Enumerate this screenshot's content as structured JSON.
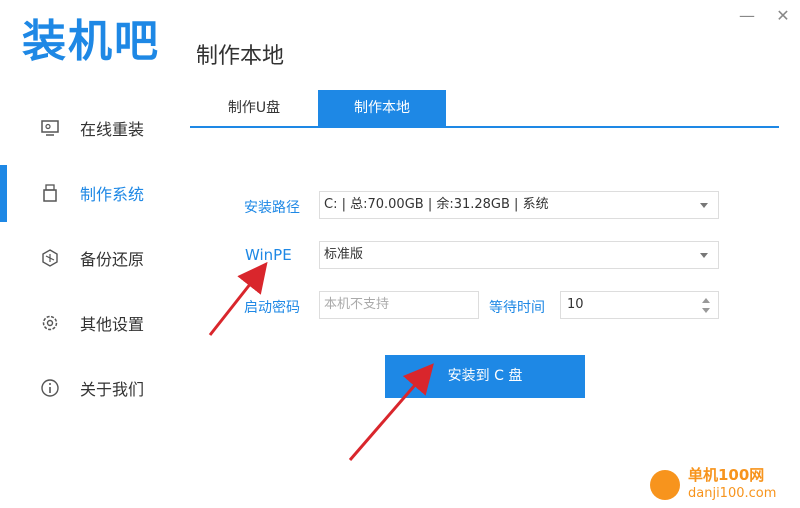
{
  "app": {
    "logo_text": "装机吧"
  },
  "window": {
    "minimize_label": "—",
    "close_label": "✕"
  },
  "sidebar": {
    "items": [
      {
        "label": "在线重装",
        "icon": "monitor-icon",
        "active": false
      },
      {
        "label": "制作系统",
        "icon": "usb-icon",
        "active": true
      },
      {
        "label": "备份还原",
        "icon": "backup-icon",
        "active": false
      },
      {
        "label": "其他设置",
        "icon": "gear-icon",
        "active": false
      },
      {
        "label": "关于我们",
        "icon": "info-icon",
        "active": false
      }
    ]
  },
  "main": {
    "title": "制作本地",
    "tabs": [
      {
        "label": "制作U盘",
        "active": false
      },
      {
        "label": "制作本地",
        "active": true
      }
    ],
    "form": {
      "path_label": "安装路径",
      "path_value": "C: | 总:70.00GB | 余:31.28GB | 系统",
      "winpe_label": "WinPE",
      "winpe_value": "标准版",
      "password_label": "启动密码",
      "password_placeholder": "本机不支持",
      "wait_label": "等待时间",
      "wait_value": "10"
    },
    "install_button": "安装到 C 盘"
  },
  "watermark": {
    "title": "单机100网",
    "url": "danji100.com"
  },
  "colors": {
    "accent": "#1e88e5",
    "arrow": "#d9262c",
    "watermark": "#f7941d"
  }
}
